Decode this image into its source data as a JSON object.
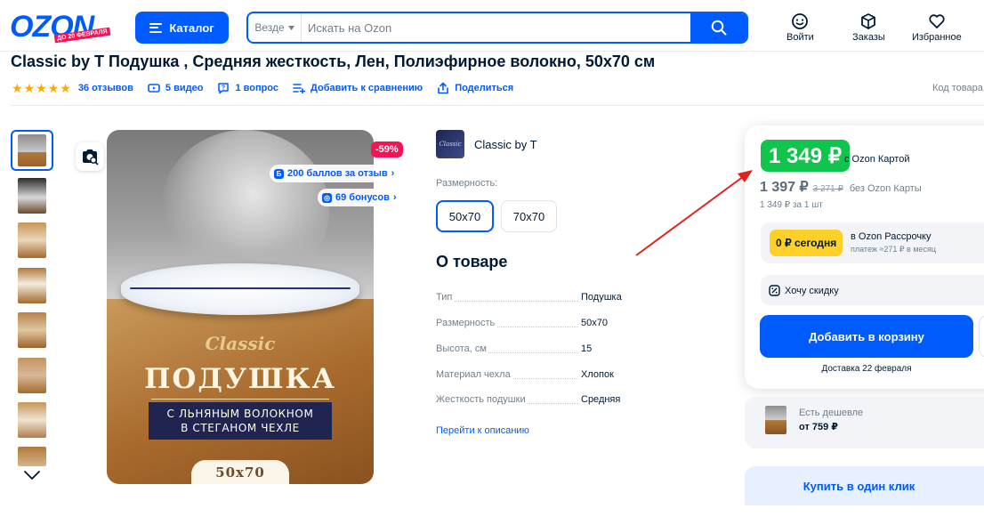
{
  "header": {
    "logo_text": "OZON",
    "logo_ribbon": "ДО 20 ФЕВРАЛЯ",
    "catalog_label": "Каталог",
    "search_scope": "Везде",
    "search_placeholder": "Искать на Ozon",
    "actions": [
      {
        "label": "Войти",
        "icon": "smile-icon"
      },
      {
        "label": "Заказы",
        "icon": "box-icon"
      },
      {
        "label": "Избранное",
        "icon": "heart-icon"
      }
    ]
  },
  "product": {
    "title": "Classic by T Подушка , Средняя жесткость, Лен, Полиэфирное волокно, 50х70 см",
    "rating_stars": 5,
    "reviews": "36 отзывов",
    "videos": "5 видео",
    "questions": "1 вопрос",
    "compare": "Добавить к сравнению",
    "share": "Поделиться",
    "code_label": "Код товара"
  },
  "gallery": {
    "discount_badge": "-59%",
    "chip_points": "200 баллов за отзыв",
    "chip_bonus": "69 бонусов",
    "image_text": {
      "brand": "Classic",
      "name": "ПОДУШКА",
      "fiber_line1": "С ЛЬНЯНЫМ ВОЛОКНОМ",
      "fiber_line2": "В СТЕГАНОМ ЧЕХЛЕ",
      "size": "50х70"
    },
    "thumbnail_count": 8
  },
  "info": {
    "brand_name": "Classic by T",
    "brand_logo_text": "Classic",
    "size_label": "Размерность:",
    "sizes": [
      {
        "label": "50х70",
        "selected": true
      },
      {
        "label": "70х70",
        "selected": false
      }
    ],
    "about_title": "О товаре",
    "characteristics": [
      {
        "name": "Тип",
        "value": "Подушка"
      },
      {
        "name": "Размерность",
        "value": "50х70"
      },
      {
        "name": "Высота, см",
        "value": "15"
      },
      {
        "name": "Материал чехла",
        "value": "Хлопок"
      },
      {
        "name": "Жесткость подушки",
        "value": "Средняя"
      }
    ],
    "description_link": "Перейти к описанию"
  },
  "buy_box": {
    "price_card": "1 349 ₽",
    "price_card_label": "с Ozon Картой",
    "price_no_card": "1 397 ₽",
    "price_old": "3 271 ₽",
    "price_no_card_label": "без Ozon Карты",
    "per_unit": "1 349 ₽ за 1 шт",
    "installment_badge": "0 ₽ сегодня",
    "installment_title": "в Ozon Рассрочку",
    "installment_sub": "платеж ≈271 ₽ в месяц",
    "want_discount": "Хочу скидку",
    "add_to_cart": "Добавить в корзину",
    "delivery": "Доставка 22 февраля",
    "cheaper_label": "Есть дешевле",
    "cheaper_price": "от 759 ₽",
    "one_click": "Купить в один клик"
  },
  "colors": {
    "brand_blue": "#005bff",
    "price_green": "#10c44c",
    "discount_pink": "#f91155",
    "installment_yellow": "#ffd028",
    "annotation_arrow": "#e3201b"
  }
}
